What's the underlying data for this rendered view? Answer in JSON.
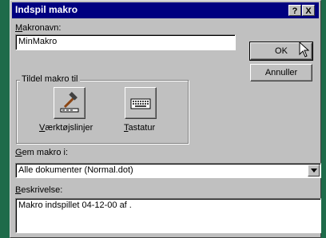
{
  "window": {
    "title": "Indspil makro"
  },
  "titlebar_buttons": {
    "help": "?",
    "close": "X"
  },
  "macro_name": {
    "label": "Makronavn:",
    "accel": "M",
    "value": "MinMakro"
  },
  "buttons": {
    "ok": "OK",
    "cancel": "Annuller"
  },
  "assign_group": {
    "legend": "Tildel makro til",
    "toolbars": {
      "label": "Værktøjslinjer",
      "accel": "V",
      "icon": "hammer-toolbar-icon"
    },
    "keyboard": {
      "label": "Tastatur",
      "accel": "T",
      "icon": "keyboard-icon"
    }
  },
  "store_in": {
    "label": "Gem makro i:",
    "accel": "G",
    "selected": "Alle dokumenter (Normal.dot)"
  },
  "description": {
    "label": "Beskrivelse:",
    "accel": "B",
    "value": "Makro indspillet 04-12-00 af ."
  }
}
